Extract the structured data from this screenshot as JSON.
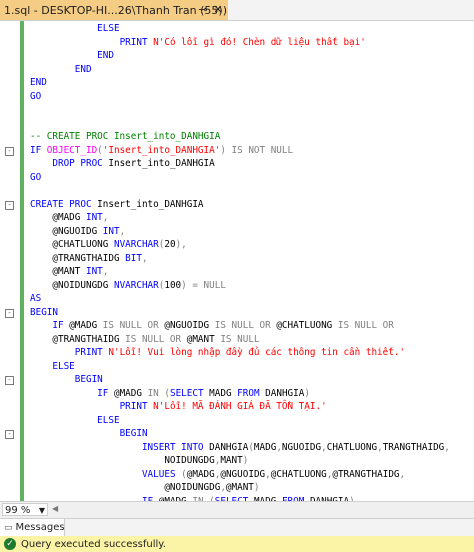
{
  "tab": {
    "title": "1.sql - DESKTOP-HI...26\\Thanh Tran (55))",
    "pin_icon": "pin-icon",
    "close_icon": "close-icon"
  },
  "code_lines": [
    [
      {
        "t": "            ",
        "c": "p"
      },
      {
        "t": "ELSE",
        "c": "k"
      }
    ],
    [
      {
        "t": "                ",
        "c": "p"
      },
      {
        "t": "PRINT ",
        "c": "k"
      },
      {
        "t": "N'Có lỗi gì đó! Chèn dữ liệu thất bại'",
        "c": "s"
      }
    ],
    [
      {
        "t": "            ",
        "c": "p"
      },
      {
        "t": "END",
        "c": "k"
      }
    ],
    [
      {
        "t": "        ",
        "c": "p"
      },
      {
        "t": "END",
        "c": "k"
      }
    ],
    [
      {
        "t": "END",
        "c": "k"
      }
    ],
    [
      {
        "t": "GO",
        "c": "k"
      }
    ],
    [],
    [],
    [
      {
        "t": "-- CREATE PROC Insert_into_DANHGIA",
        "c": "c"
      }
    ],
    [
      {
        "t": "IF ",
        "c": "k"
      },
      {
        "t": "OBJECT_ID",
        "c": "f"
      },
      {
        "t": "(",
        "c": "g"
      },
      {
        "t": "'Insert_into_DANHGIA'",
        "c": "s"
      },
      {
        "t": ") ",
        "c": "g"
      },
      {
        "t": "IS NOT NULL",
        "c": "g"
      }
    ],
    [
      {
        "t": "    ",
        "c": "p"
      },
      {
        "t": "DROP PROC ",
        "c": "k"
      },
      {
        "t": "Insert_into_DANHGIA",
        "c": "p"
      }
    ],
    [
      {
        "t": "GO",
        "c": "k"
      }
    ],
    [],
    [
      {
        "t": "CREATE PROC ",
        "c": "k"
      },
      {
        "t": "Insert_into_DANHGIA",
        "c": "p"
      }
    ],
    [
      {
        "t": "    @MADG ",
        "c": "p"
      },
      {
        "t": "INT",
        "c": "k"
      },
      {
        "t": ",",
        "c": "g"
      }
    ],
    [
      {
        "t": "    @NGUOIDG ",
        "c": "p"
      },
      {
        "t": "INT",
        "c": "k"
      },
      {
        "t": ",",
        "c": "g"
      }
    ],
    [
      {
        "t": "    @CHATLUONG ",
        "c": "p"
      },
      {
        "t": "NVARCHAR",
        "c": "k"
      },
      {
        "t": "(",
        "c": "g"
      },
      {
        "t": "20",
        "c": "p"
      },
      {
        "t": "),",
        "c": "g"
      }
    ],
    [
      {
        "t": "    @TRANGTHAIDG ",
        "c": "p"
      },
      {
        "t": "BIT",
        "c": "k"
      },
      {
        "t": ",",
        "c": "g"
      }
    ],
    [
      {
        "t": "    @MANT ",
        "c": "p"
      },
      {
        "t": "INT",
        "c": "k"
      },
      {
        "t": ",",
        "c": "g"
      }
    ],
    [
      {
        "t": "    @NOIDUNGDG ",
        "c": "p"
      },
      {
        "t": "NVARCHAR",
        "c": "k"
      },
      {
        "t": "(",
        "c": "g"
      },
      {
        "t": "100",
        "c": "p"
      },
      {
        "t": ") = NULL",
        "c": "g"
      }
    ],
    [
      {
        "t": "AS",
        "c": "k"
      }
    ],
    [
      {
        "t": "BEGIN",
        "c": "k"
      }
    ],
    [
      {
        "t": "    ",
        "c": "p"
      },
      {
        "t": "IF ",
        "c": "k"
      },
      {
        "t": "@MADG ",
        "c": "p"
      },
      {
        "t": "IS NULL OR ",
        "c": "g"
      },
      {
        "t": "@NGUOIDG ",
        "c": "p"
      },
      {
        "t": "IS NULL OR ",
        "c": "g"
      },
      {
        "t": "@CHATLUONG ",
        "c": "p"
      },
      {
        "t": "IS NULL OR",
        "c": "g"
      }
    ],
    [
      {
        "t": "    @TRANGTHAIDG ",
        "c": "p"
      },
      {
        "t": "IS NULL OR ",
        "c": "g"
      },
      {
        "t": "@MANT ",
        "c": "p"
      },
      {
        "t": "IS NULL",
        "c": "g"
      }
    ],
    [
      {
        "t": "        ",
        "c": "p"
      },
      {
        "t": "PRINT ",
        "c": "k"
      },
      {
        "t": "N'Lỗi! Vui lòng nhập đầy đủ các thông tin cần thiết.'",
        "c": "s"
      }
    ],
    [
      {
        "t": "    ",
        "c": "p"
      },
      {
        "t": "ELSE",
        "c": "k"
      }
    ],
    [
      {
        "t": "        ",
        "c": "p"
      },
      {
        "t": "BEGIN",
        "c": "k"
      }
    ],
    [
      {
        "t": "            ",
        "c": "p"
      },
      {
        "t": "IF ",
        "c": "k"
      },
      {
        "t": "@MADG ",
        "c": "p"
      },
      {
        "t": "IN ",
        "c": "g"
      },
      {
        "t": "(",
        "c": "g"
      },
      {
        "t": "SELECT ",
        "c": "k"
      },
      {
        "t": "MADG ",
        "c": "p"
      },
      {
        "t": "FROM ",
        "c": "k"
      },
      {
        "t": "DANHGIA",
        "c": "p"
      },
      {
        "t": ")",
        "c": "g"
      }
    ],
    [
      {
        "t": "                ",
        "c": "p"
      },
      {
        "t": "PRINT ",
        "c": "k"
      },
      {
        "t": "N'Lỗi! MÃ ĐÁNH GIÁ ĐÃ TỒN TẠI.'",
        "c": "s"
      }
    ],
    [
      {
        "t": "            ",
        "c": "p"
      },
      {
        "t": "ELSE",
        "c": "k"
      }
    ],
    [
      {
        "t": "                ",
        "c": "p"
      },
      {
        "t": "BEGIN",
        "c": "k"
      }
    ],
    [
      {
        "t": "                    ",
        "c": "p"
      },
      {
        "t": "INSERT INTO ",
        "c": "k"
      },
      {
        "t": "DANHGIA",
        "c": "p"
      },
      {
        "t": "(",
        "c": "g"
      },
      {
        "t": "MADG",
        "c": "p"
      },
      {
        "t": ",",
        "c": "g"
      },
      {
        "t": "NGUOIDG",
        "c": "p"
      },
      {
        "t": ",",
        "c": "g"
      },
      {
        "t": "CHATLUONG",
        "c": "p"
      },
      {
        "t": ",",
        "c": "g"
      },
      {
        "t": "TRANGTHAIDG",
        "c": "p"
      },
      {
        "t": ",",
        "c": "g"
      }
    ],
    [
      {
        "t": "                        NOIDUNGDG",
        "c": "p"
      },
      {
        "t": ",",
        "c": "g"
      },
      {
        "t": "MANT",
        "c": "p"
      },
      {
        "t": ")",
        "c": "g"
      }
    ],
    [
      {
        "t": "                    ",
        "c": "p"
      },
      {
        "t": "VALUES ",
        "c": "k"
      },
      {
        "t": "(",
        "c": "g"
      },
      {
        "t": "@MADG",
        "c": "p"
      },
      {
        "t": ",",
        "c": "g"
      },
      {
        "t": "@NGUOIDG",
        "c": "p"
      },
      {
        "t": ",",
        "c": "g"
      },
      {
        "t": "@CHATLUONG",
        "c": "p"
      },
      {
        "t": ",",
        "c": "g"
      },
      {
        "t": "@TRANGTHAIDG",
        "c": "p"
      },
      {
        "t": ",",
        "c": "g"
      }
    ],
    [
      {
        "t": "                        @NOIDUNGDG",
        "c": "p"
      },
      {
        "t": ",",
        "c": "g"
      },
      {
        "t": "@MANT",
        "c": "p"
      },
      {
        "t": ")",
        "c": "g"
      }
    ],
    [
      {
        "t": "                    ",
        "c": "p"
      },
      {
        "t": "IF ",
        "c": "k"
      },
      {
        "t": "@MADG ",
        "c": "p"
      },
      {
        "t": "IN ",
        "c": "g"
      },
      {
        "t": "(",
        "c": "g"
      },
      {
        "t": "SELECT ",
        "c": "k"
      },
      {
        "t": "MADG ",
        "c": "p"
      },
      {
        "t": "FROM ",
        "c": "k"
      },
      {
        "t": "DANHGIA",
        "c": "p"
      },
      {
        "t": ")",
        "c": "g"
      }
    ]
  ],
  "fold_markers": [
    "-",
    "-",
    "-",
    "-",
    "-",
    "-",
    "-"
  ],
  "zoom": "99 %",
  "results_tab": {
    "label": "Messages"
  },
  "status": {
    "message": "Query executed successfully."
  },
  "colors": {
    "tab_active": "#f5cc84",
    "status_bg": "#fbf3a5",
    "change_bar": "#5fb25f",
    "keyword": "#0000ff",
    "string": "#ff0000",
    "comment": "#008000",
    "function": "#ff00ff"
  }
}
